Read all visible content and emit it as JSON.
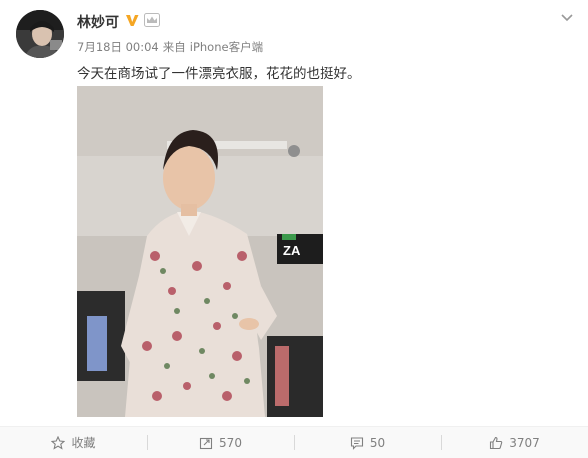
{
  "post": {
    "username": "林妙可",
    "date": "7月18日 00:04",
    "via": "来自",
    "source": "iPhone客户端",
    "text": "今天在商场试了一件漂亮衣服，花花的也挺好。"
  },
  "actions": {
    "favorite_label": "收藏",
    "repost_count": "570",
    "comment_count": "50",
    "like_count": "3707"
  },
  "photo_signs": {
    "brand_sign": "ZA"
  },
  "icons": {
    "verified": "verified-v-icon",
    "member": "crown-icon",
    "menu": "chevron-down-icon",
    "favorite": "star-icon",
    "repost": "repost-icon",
    "comment": "comment-icon",
    "like": "thumbs-up-icon"
  },
  "colors": {
    "verified": "#f5a623",
    "text": "#333333",
    "meta": "#808080",
    "action_bar": "#f9f9f9"
  }
}
